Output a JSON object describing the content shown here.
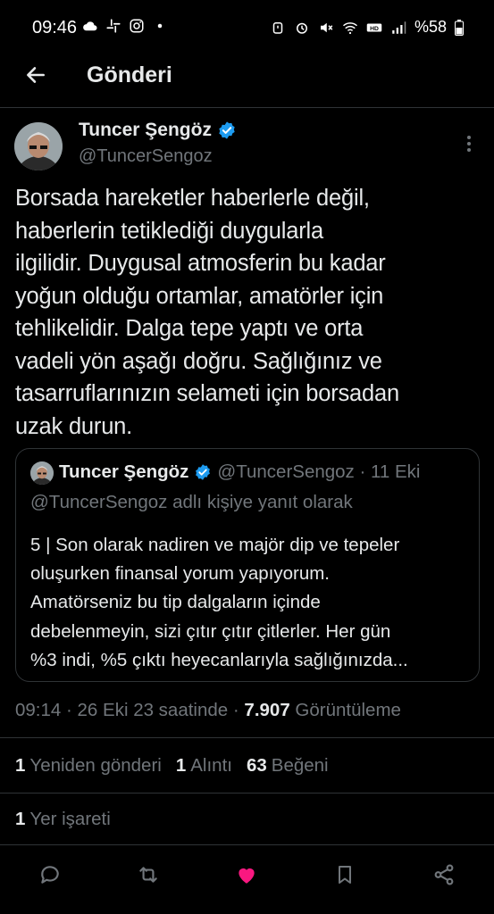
{
  "status_bar": {
    "time": "09:46",
    "battery": "%58",
    "left_icons": [
      "cloud-icon",
      "slack-icon",
      "instagram-icon",
      "dot-icon"
    ],
    "right_icons": [
      "alarm-icon",
      "clock-icon",
      "mute-icon",
      "wifi-icon",
      "hd-icon",
      "signal-icon",
      "battery-icon"
    ]
  },
  "header": {
    "title": "Gönderi",
    "back_icon": "arrow-left-icon"
  },
  "tweet": {
    "author_name": "Tuncer Şengöz",
    "author_handle": "@TuncerSengoz",
    "verified": true,
    "text": "Borsada hareketler haberlerle değil,\nhaberlerin tetiklediği duygularla\nilgilidir. Duygusal atmosferin bu kadar\nyoğun olduğu ortamlar, amatörler için\ntehlikelidir. Dalga tepe yaptı ve orta\nvadeli yön aşağı doğru. Sağlığınız ve\ntasarruflarınızın selameti için borsadan\nuzak durun.",
    "timestamp": "09:14 · 26 Eki 23 saatinde · ",
    "views_count": "7.907",
    "views_label": " Görüntüleme"
  },
  "quote": {
    "author_name": "Tuncer Şengöz",
    "meta": "@TuncerSengoz · 11 Eki",
    "reply_to": "@TuncerSengoz adlı kişiye yanıt olarak",
    "text": "5 | Son olarak nadiren ve majör dip ve tepeler\noluşurken finansal yorum yapıyorum.\nAmatörseniz bu tip dalgaların içinde\ndebelenmeyin, sizi çıtır çıtır çitlerler. Her gün\n%3 indi, %5 çıktı heyecanlarıyla sağlığınızda..."
  },
  "stats": {
    "reposts_count": "1",
    "reposts_label": "Yeniden gönderi",
    "quotes_count": "1",
    "quotes_label": "Alıntı",
    "likes_count": "63",
    "likes_label": "Beğeni",
    "bookmarks_count": "1",
    "bookmarks_label": "Yer işareti"
  },
  "actions": [
    "reply-icon",
    "repost-icon",
    "like-icon",
    "bookmark-icon",
    "share-icon"
  ],
  "colors": {
    "background": "#000000",
    "text": "#e7e9ea",
    "muted": "#71767b",
    "divider": "#2f3336",
    "verified": "#1d9bf0",
    "like": "#f91880"
  }
}
